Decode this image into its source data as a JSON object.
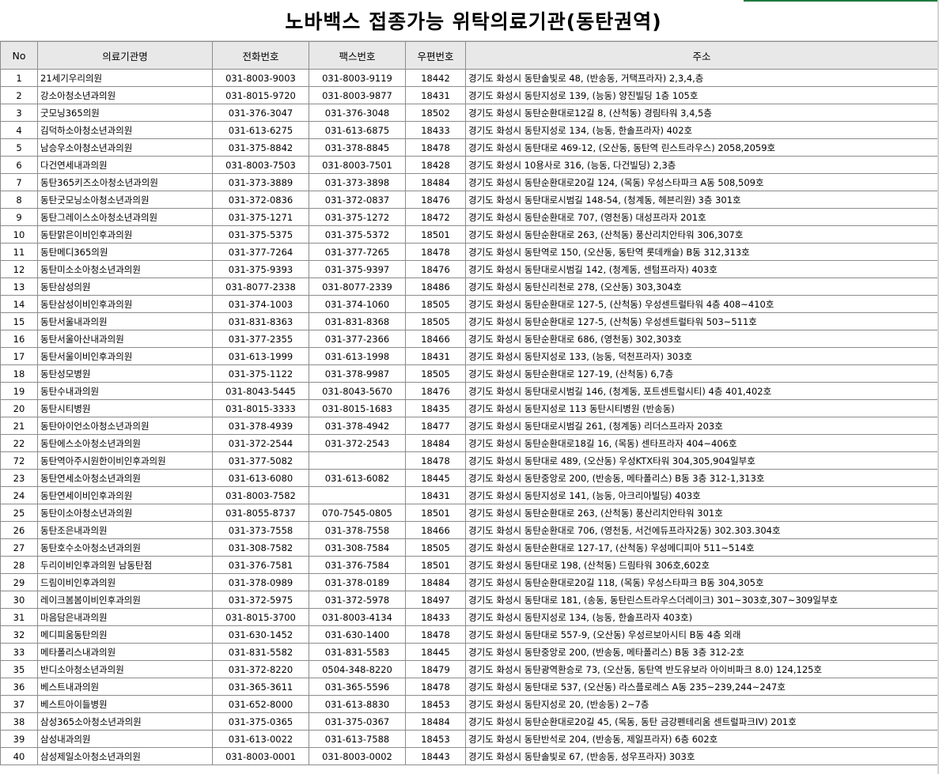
{
  "title": "노바백스 접종가능 위탁의료기관(동탄권역)",
  "headers": {
    "no": "No",
    "name": "의료기관명",
    "phone": "전화번호",
    "fax": "팩스번호",
    "zip": "우편번호",
    "address": "주소"
  },
  "rows": [
    {
      "no": "1",
      "name": "21세기우리의원",
      "phone": "031-8003-9003",
      "fax": "031-8003-9119",
      "zip": "18442",
      "address": "경기도 화성시 동탄솔빛로 48, (반송동, 거택프라자) 2,3,4,층"
    },
    {
      "no": "2",
      "name": "강소아청소년과의원",
      "phone": "031-8015-9720",
      "fax": "031-8003-9877",
      "zip": "18431",
      "address": "경기도 화성시 동탄지성로 139, (능동) 양진빌딩 1층 105호"
    },
    {
      "no": "3",
      "name": "굿모닝365의원",
      "phone": "031-376-3047",
      "fax": "031-376-3048",
      "zip": "18502",
      "address": "경기도 화성시 동탄순환대로12길 8, (산척동) 경림타워 3,4,5층"
    },
    {
      "no": "4",
      "name": "김덕하소아청소년과의원",
      "phone": "031-613-6275",
      "fax": "031-613-6875",
      "zip": "18433",
      "address": "경기도 화성시 동탄지성로 134, (능동, 한솔프라자) 402호"
    },
    {
      "no": "5",
      "name": "남승우소아청소년과의원",
      "phone": "031-375-8842",
      "fax": "031-378-8845",
      "zip": "18478",
      "address": "경기도 화성시 동탄대로 469-12, (오산동, 동탄역 린스트라우스) 2058,2059호"
    },
    {
      "no": "6",
      "name": "다건연세내과의원",
      "phone": "031-8003-7503",
      "fax": "031-8003-7501",
      "zip": "18428",
      "address": "경기도 화성시 10용사로 316, (능동, 다건빌딩) 2,3층"
    },
    {
      "no": "7",
      "name": "동탄365키즈소아청소년과의원",
      "phone": "031-373-3889",
      "fax": "031-373-3898",
      "zip": "18484",
      "address": "경기도 화성시 동탄순환대로20길 124, (목동) 우성스타파크 A동 508,509호"
    },
    {
      "no": "8",
      "name": "동탄굿모닝소아청소년과의원",
      "phone": "031-372-0836",
      "fax": "031-372-0837",
      "zip": "18476",
      "address": "경기도 화성시 동탄대로시범길 148-54, (청계동, 헤븐리원) 3층 301호"
    },
    {
      "no": "9",
      "name": "동탄그레이스소아청소년과의원",
      "phone": "031-375-1271",
      "fax": "031-375-1272",
      "zip": "18472",
      "address": "경기도 화성시 동탄순환대로 707, (영천동) 대성프라자 201호"
    },
    {
      "no": "10",
      "name": "동탄맑은이비인후과의원",
      "phone": "031-375-5375",
      "fax": "031-375-5372",
      "zip": "18501",
      "address": "경기도 화성시 동탄순환대로 263, (산척동) 풍산리치안타워 306,307호"
    },
    {
      "no": "11",
      "name": "동탄메디365의원",
      "phone": "031-377-7264",
      "fax": "031-377-7265",
      "zip": "18478",
      "address": "경기도 화성시 동탄역로 150, (오산동, 동탄역 롯데캐슬) B동 312,313호"
    },
    {
      "no": "12",
      "name": "동탄미소소아청소년과의원",
      "phone": "031-375-9393",
      "fax": "031-375-9397",
      "zip": "18476",
      "address": "경기도 화성시 동탄대로시범길 142, (청계동, 센텀프라자) 403호"
    },
    {
      "no": "13",
      "name": "동탄삼성의원",
      "phone": "031-8077-2338",
      "fax": "031-8077-2339",
      "zip": "18486",
      "address": "경기도 화성시 동탄신리천로 278, (오산동) 303,304호"
    },
    {
      "no": "14",
      "name": "동탄삼성이비인후과의원",
      "phone": "031-374-1003",
      "fax": "031-374-1060",
      "zip": "18505",
      "address": "경기도 화성시 동탄순환대로 127-5, (산척동) 우성센트럴타워 4층 408~410호"
    },
    {
      "no": "15",
      "name": "동탄서울내과의원",
      "phone": "031-831-8363",
      "fax": "031-831-8368",
      "zip": "18505",
      "address": "경기도 화성시 동탄순환대로 127-5, (산척동) 우성센트럴타워 503~511호"
    },
    {
      "no": "16",
      "name": "동탄서울아산내과의원",
      "phone": "031-377-2355",
      "fax": "031-377-2366",
      "zip": "18466",
      "address": "경기도 화성시 동탄순환대로 686, (영천동) 302,303호"
    },
    {
      "no": "17",
      "name": "동탄서울이비인후과의원",
      "phone": "031-613-1999",
      "fax": "031-613-1998",
      "zip": "18431",
      "address": "경기도 화성시 동탄지성로 133, (능동, 덕천프라자) 303호"
    },
    {
      "no": "18",
      "name": "동탄성모병원",
      "phone": "031-375-1122",
      "fax": "031-378-9987",
      "zip": "18505",
      "address": "경기도 화성시 동탄순환대로 127-19, (산척동) 6,7층"
    },
    {
      "no": "19",
      "name": "동탄수내과의원",
      "phone": "031-8043-5445",
      "fax": "031-8043-5670",
      "zip": "18476",
      "address": "경기도 화성시 동탄대로시범길 146, (청계동, 포트센트럴시티) 4층 401,402호"
    },
    {
      "no": "20",
      "name": "동탄시티병원",
      "phone": "031-8015-3333",
      "fax": "031-8015-1683",
      "zip": "18435",
      "address": "경기도 화성시 동탄지성로 113 동탄시티병원 (반송동)"
    },
    {
      "no": "21",
      "name": "동탄아이언소아청소년과의원",
      "phone": "031-378-4939",
      "fax": "031-378-4942",
      "zip": "18477",
      "address": "경기도 화성시 동탄대로시범길 261, (청계동) 리더스프라자 203호"
    },
    {
      "no": "22",
      "name": "동탄에스소아청소년과의원",
      "phone": "031-372-2544",
      "fax": "031-372-2543",
      "zip": "18484",
      "address": "경기도 화성시 동탄순환대로18길 16, (목동) 센타프라자 404~406호"
    },
    {
      "no": "72",
      "name": "동탄역아주시원한이비인후과의원",
      "phone": "031-377-5082",
      "fax": "",
      "zip": "18478",
      "address": "경기도 화성시 동탄대로 489, (오산동) 우성KTX타워 304,305,904일부호"
    },
    {
      "no": "23",
      "name": "동탄연세소아청소년과의원",
      "phone": "031-613-6080",
      "fax": "031-613-6082",
      "zip": "18445",
      "address": "경기도 화성시 동탄중앙로 200, (반송동, 메타폴리스) B동 3층 312-1,313호"
    },
    {
      "no": "24",
      "name": "동탄연세이비인후과의원",
      "phone": "031-8003-7582",
      "fax": "",
      "zip": "18431",
      "address": "경기도 화성시 동탄지성로 141, (능동, 아크리아빌딩) 403호"
    },
    {
      "no": "25",
      "name": "동탄이소아청소년과의원",
      "phone": "031-8055-8737",
      "fax": "070-7545-0805",
      "zip": "18501",
      "address": "경기도 화성시 동탄순환대로 263, (산척동) 풍산리치안타워 301호"
    },
    {
      "no": "26",
      "name": "동탄조은내과의원",
      "phone": "031-373-7558",
      "fax": "031-378-7558",
      "zip": "18466",
      "address": "경기도 화성시 동탄순환대로 706, (영천동, 서건에듀프라자2동) 302.303.304호"
    },
    {
      "no": "27",
      "name": "동탄호수소아청소년과의원",
      "phone": "031-308-7582",
      "fax": "031-308-7584",
      "zip": "18505",
      "address": "경기도 화성시 동탄순환대로 127-17, (산척동) 우성메디피아 511~514호"
    },
    {
      "no": "28",
      "name": "두리이비인후과의원 남동탄점",
      "phone": "031-376-7581",
      "fax": "031-376-7584",
      "zip": "18501",
      "address": "경기도 화성시 동탄대로 198, (산척동) 드림타워 306호,602호"
    },
    {
      "no": "29",
      "name": "드림이비인후과의원",
      "phone": "031-378-0989",
      "fax": "031-378-0189",
      "zip": "18484",
      "address": "경기도 화성시 동탄순환대로20길 118, (목동) 우성스타파크 B동 304,305호"
    },
    {
      "no": "30",
      "name": "레이크봄봄이비인후과의원",
      "phone": "031-372-5975",
      "fax": "031-372-5978",
      "zip": "18497",
      "address": "경기도 화성시 동탄대로 181, (송동, 동탄린스트라우스더레이크) 301~303호,307~309일부호"
    },
    {
      "no": "31",
      "name": "마음담은내과의원",
      "phone": "031-8015-3700",
      "fax": "031-8003-4134",
      "zip": "18433",
      "address": "경기도 화성시 동탄지성로 134, (능동, 한솔프라자 403호)"
    },
    {
      "no": "32",
      "name": "메디피움동탄의원",
      "phone": "031-630-1452",
      "fax": "031-630-1400",
      "zip": "18478",
      "address": "경기도 화성시 동탄대로 557-9, (오산동) 우성르보아시티 B동 4층 외래"
    },
    {
      "no": "33",
      "name": "메타폴리스내과의원",
      "phone": "031-831-5582",
      "fax": "031-831-5583",
      "zip": "18445",
      "address": "경기도 화성시 동탄중앙로 200, (반송동, 메타폴리스) B동 3층 312-2호"
    },
    {
      "no": "35",
      "name": "반디소아청소년과의원",
      "phone": "031-372-8220",
      "fax": "0504-348-8220",
      "zip": "18479",
      "address": "경기도 화성시 동탄광역환승로 73, (오산동, 동탄역 반도유보라 아이비파크 8.0) 124,125호"
    },
    {
      "no": "36",
      "name": "베스트내과의원",
      "phone": "031-365-3611",
      "fax": "031-365-5596",
      "zip": "18478",
      "address": "경기도 화성시 동탄대로 537, (오산동) 라스플로레스 A동 235~239,244~247호"
    },
    {
      "no": "37",
      "name": "베스트아이들병원",
      "phone": "031-652-8000",
      "fax": "031-613-8830",
      "zip": "18453",
      "address": "경기도 화성시 동탄지성로 20, (반송동) 2~7층"
    },
    {
      "no": "38",
      "name": "삼성365소아청소년과의원",
      "phone": "031-375-0365",
      "fax": "031-375-0367",
      "zip": "18484",
      "address": "경기도 화성시 동탄순환대로20길 45, (목동, 동탄 금강펜테리움 센트럴파크IV) 201호"
    },
    {
      "no": "39",
      "name": "삼성내과의원",
      "phone": "031-613-0022",
      "fax": "031-613-7588",
      "zip": "18453",
      "address": "경기도 화성시 동탄반석로 204, (반송동, 제일프라자) 6층 602호"
    },
    {
      "no": "40",
      "name": "삼성제일소아청소년과의원",
      "phone": "031-8003-0001",
      "fax": "031-8003-0002",
      "zip": "18443",
      "address": "경기도 화성시 동탄솔빛로 67, (반송동, 성우프라자) 303호"
    }
  ]
}
